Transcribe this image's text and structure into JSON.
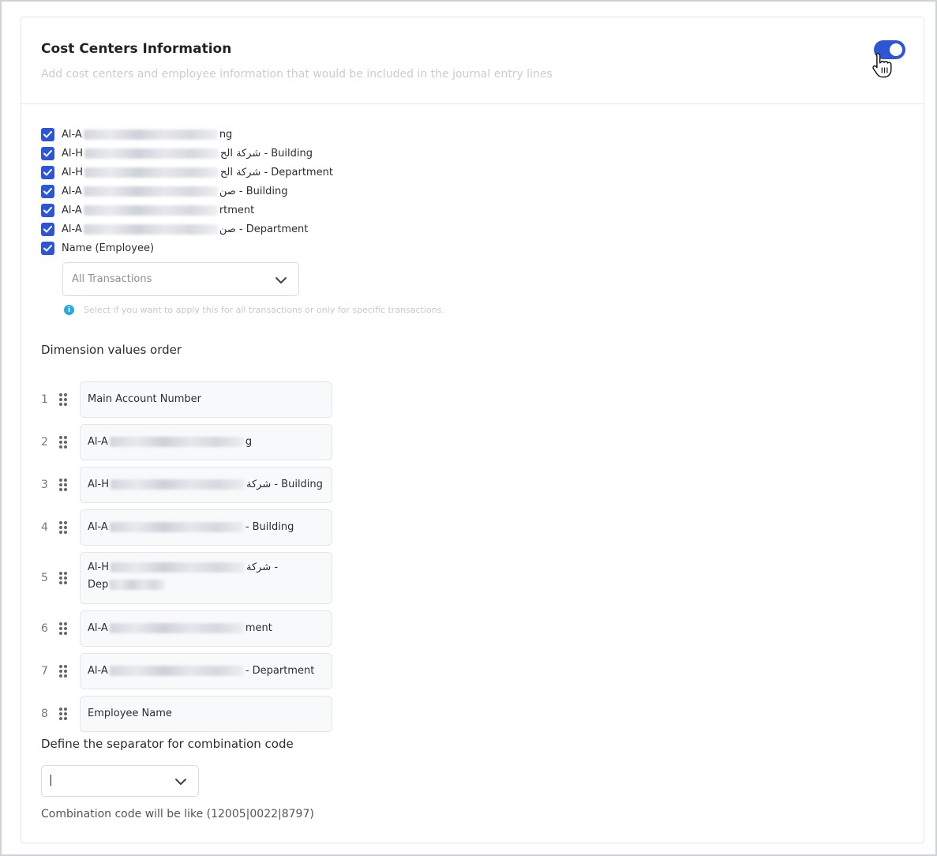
{
  "card": {
    "title": "Cost Centers Information",
    "subtitle": "Add cost centers and employee information that would be included in the journal entry lines",
    "toggle_on": true
  },
  "checkboxes": [
    {
      "prefix": "Al-A",
      "suffix": "ng",
      "checked": true
    },
    {
      "prefix": "Al-H",
      "suffix": "شركة الح - Building",
      "checked": true
    },
    {
      "prefix": "Al-H",
      "suffix": "شركة الح - Department",
      "checked": true
    },
    {
      "prefix": "Al-A",
      "suffix": "صن - Building",
      "checked": true
    },
    {
      "prefix": "Al-A",
      "suffix": "rtment",
      "checked": true
    },
    {
      "prefix": "Al-A",
      "suffix": "صن - Department",
      "checked": true
    },
    {
      "label": "Name (Employee)",
      "checked": true
    }
  ],
  "transactions_select": {
    "value": "All Transactions",
    "hint": "Select if you want to apply this for all transactions or only for specific transactions."
  },
  "dimension": {
    "title": "Dimension values order",
    "items": [
      {
        "num": "1",
        "prefix": "Main Account Number",
        "suffix": ""
      },
      {
        "num": "2",
        "prefix": "Al-A",
        "suffix": "g"
      },
      {
        "num": "3",
        "prefix": "Al-H",
        "suffix": "شركة - Building"
      },
      {
        "num": "4",
        "prefix": "Al-A",
        "suffix": "- Building"
      },
      {
        "num": "5",
        "prefix": "Al-H",
        "suffix": "شركة -",
        "line2": "Dep"
      },
      {
        "num": "6",
        "prefix": "Al-A",
        "suffix": "ment"
      },
      {
        "num": "7",
        "prefix": "Al-A",
        "suffix": "- Department"
      },
      {
        "num": "8",
        "prefix": "Employee Name",
        "suffix": ""
      }
    ]
  },
  "separator": {
    "title": "Define the separator for combination code",
    "value": "|",
    "note": "Combination code will be like (12005|0022|8797)"
  },
  "colors": {
    "accent": "#2d55d8",
    "info": "#29a9e0"
  }
}
